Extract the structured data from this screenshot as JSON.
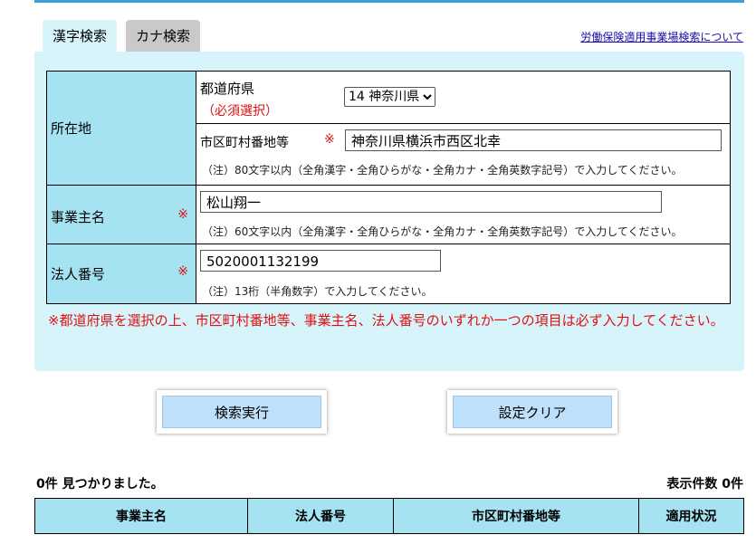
{
  "tabs": {
    "kanji": "漢字検索",
    "kana": "カナ検索"
  },
  "help_link": "労働保険適用事業場検索について",
  "form": {
    "location_label": "所在地",
    "prefecture_label": "都道府県",
    "prefecture_required": "（必須選択）",
    "prefecture_selected": "14 神奈川県",
    "municipality_label": "市区町村番地等",
    "municipality_req_mark": "※",
    "municipality_value": "神奈川県横浜市西区北幸",
    "municipality_note": "（注）80文字以内（全角漢字・全角ひらがな・全角カナ・全角英数字記号）で入力してください。",
    "owner_label": "事業主名",
    "owner_req_mark": "※",
    "owner_value": "松山翔一",
    "owner_note": "（注）60文字以内（全角漢字・全角ひらがな・全角カナ・全角英数字記号）で入力してください。",
    "corp_label": "法人番号",
    "corp_req_mark": "※",
    "corp_value": "5020001132199",
    "corp_note": "（注）13桁（半角数字）で入力してください。",
    "warning": "※都道府県を選択の上、市区町村番地等、事業主名、法人番号のいずれか一つの項目は必ず入力してください。"
  },
  "buttons": {
    "search": "検索実行",
    "clear": "設定クリア"
  },
  "results": {
    "count_text": "0件 見つかりました。",
    "display_count": "表示件数 0件",
    "headers": [
      "事業主名",
      "法人番号",
      "市区町村番地等",
      "適用状況"
    ]
  }
}
